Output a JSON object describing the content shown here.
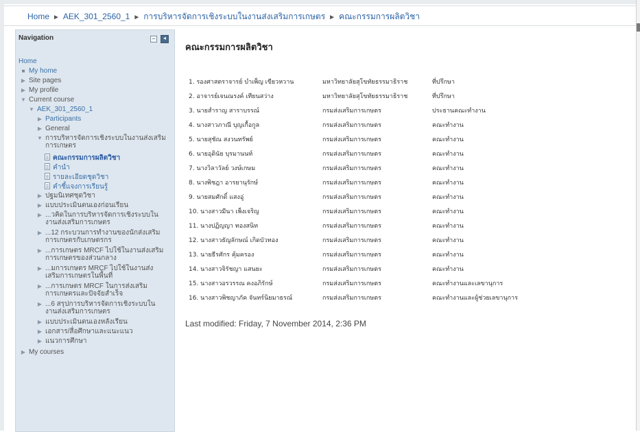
{
  "breadcrumb": [
    {
      "label": "Home"
    },
    {
      "label": "AEK_301_2560_1"
    },
    {
      "label": "การบริหารจัดการเชิงระบบในงานส่งเสริมการเกษตร"
    },
    {
      "label": "คณะกรรมการผลิตวิชา"
    }
  ],
  "sidebar": {
    "title": "Navigation",
    "home": "Home",
    "items": [
      {
        "label": "My home"
      },
      {
        "label": "Site pages"
      },
      {
        "label": "My profile"
      },
      {
        "label": "Current course"
      },
      {
        "label": "AEK_301_2560_1"
      },
      {
        "label": "Participants"
      },
      {
        "label": "General"
      },
      {
        "label": "การบริหารจัดการเชิงระบบในงานส่งเสริมการเกษตร"
      },
      {
        "label": "คณะกรรมการผลิตวิชา"
      },
      {
        "label": "คำนำ"
      },
      {
        "label": "รายละเอียดชุดวิชา"
      },
      {
        "label": "คำชี้แจงการเรียนรู้"
      },
      {
        "label": "ปฐมนิเทศชุดวิชา"
      },
      {
        "label": "แบบประเมินตนเองก่อนเรียน"
      },
      {
        "label": "...วคิดในการบริหารจัดการเชิงระบบในงานส่งเสริมการเกษตร"
      },
      {
        "label": "...12 กระบวนการทำงานของนักส่งเสริมการเกษตรกับเกษตรกร"
      },
      {
        "label": "...การเกษตร MRCF ไปใช้ในงานส่งเสริมการเกษตรของส่วนกลาง"
      },
      {
        "label": "...มการเกษตร MRCF ไปใช้ในงานส่งเสริมการเกษตรในพื้นที่"
      },
      {
        "label": "...การเกษตร MRCF ในการส่งเสริมการเกษตรและปัจจัยสำเร็จ"
      },
      {
        "label": "...6 สรุปการบริหารจัดการเชิงระบบในงานส่งเสริมการเกษตร"
      },
      {
        "label": "แบบประเมินตนเองหลังเรียน"
      },
      {
        "label": "เอกสาร/สื่อศึกษาและแนะแนว"
      },
      {
        "label": "แนวการศึกษา"
      },
      {
        "label": "My courses"
      }
    ]
  },
  "main": {
    "title": "คณะกรรมการผลิตวิชา",
    "rows": [
      [
        "1. รองศาสตราจารย์ บำเพ็ญ เขียวหวาน",
        "มหาวิทยาลัยสุโขทัยธรรมาธิราช",
        "ที่ปรึกษา"
      ],
      [
        "2. อาจารย์เจนณรงค์ เทียนสว่าง",
        "มหาวิทยาลัยสุโขทัยธรรมาธิราช",
        "ที่ปรึกษา"
      ],
      [
        "3. นายสำราญ สาราบรรณ์",
        "กรมส่งเสริมการเกษตร",
        "ประธานคณะทำงาน"
      ],
      [
        "4. นางสาวภาณี บุญเกื้อกูล",
        "กรมส่งเสริมการเกษตร",
        "คณะทำงาน"
      ],
      [
        "5. นายสุชัณ สงวนทรัพย์",
        "กรมส่งเสริมการเกษตร",
        "คณะทำงาน"
      ],
      [
        "6. นายอุดินัย บุรมานนท์",
        "กรมส่งเสริมการเกษตร",
        "คณะทำงาน"
      ],
      [
        "7. นางวิลาวัลย์ วงษ์เกษม",
        "กรมส่งเสริมการเกษตร",
        "คณะทำงาน"
      ],
      [
        "8. นางพิชฎา อารยานุรักษ์",
        "กรมส่งเสริมการเกษตร",
        "คณะทำงาน"
      ],
      [
        "9. นายสมศักดิ์ แสงอู่",
        "กรมส่งเสริมการเกษตร",
        "คณะทำงาน"
      ],
      [
        "10. นางสาวมีนา เพ็งเจริญ",
        "กรมส่งเสริมการเกษตร",
        "คณะทำงาน"
      ],
      [
        "11. นางปฏิญญา ทองสนิท",
        "กรมส่งเสริมการเกษตร",
        "คณะทำงาน"
      ],
      [
        "12. นางสาวธัญลักษณ์ เกิดบัวทอง",
        "กรมส่งเสริมการเกษตร",
        "คณะทำงาน"
      ],
      [
        "13. นายธีรศักร คุ้มครอง",
        "กรมส่งเสริมการเกษตร",
        "คณะทำงาน"
      ],
      [
        "14. นางสาวจิรัชญา แสนยะ",
        "กรมส่งเสริมการเกษตร",
        "คณะทำงาน"
      ],
      [
        "15. นางสาวอรวรรณ คงอภิรักษ์",
        "กรมส่งเสริมการเกษตร",
        "คณะทำงานและเลขานุการ"
      ],
      [
        "16. นางสาวพิชญาภัค จันทร์นิยมาธรณ์",
        "กรมส่งเสริมการเกษตร",
        "คณะทำงานและผู้ช่วยเลขานุการ"
      ]
    ],
    "last_modified": "Last modified: Friday, 7 November 2014, 2:36 PM"
  }
}
